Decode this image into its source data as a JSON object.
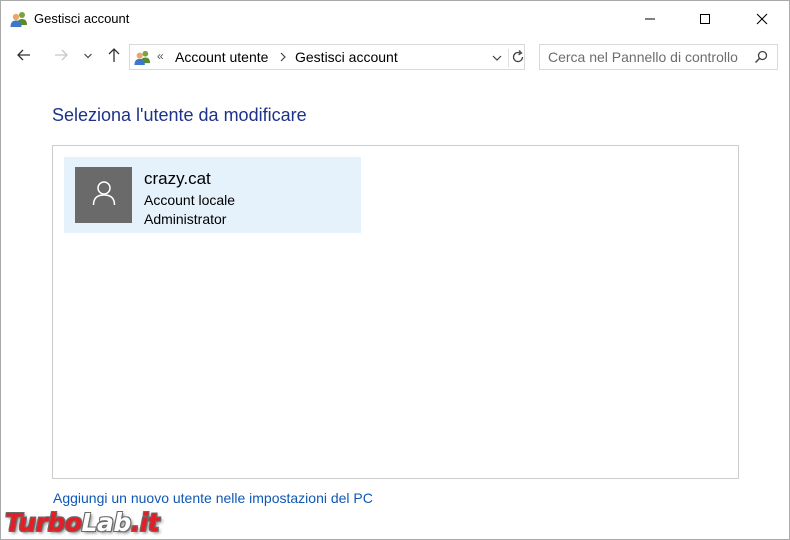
{
  "window": {
    "title": "Gestisci account",
    "icon": "users-icon",
    "controls": {
      "minimize": "minimize-icon",
      "maximize": "maximize-icon",
      "close": "close-icon"
    }
  },
  "navigation": {
    "back_icon": "arrow-left-icon",
    "forward_icon": "arrow-right-icon",
    "recent_icon": "chevron-down-icon",
    "up_icon": "arrow-up-icon"
  },
  "address_bar": {
    "overflow_marker": "«",
    "breadcrumbs": [
      "Account utente",
      "Gestisci account"
    ],
    "refresh_icon": "refresh-icon"
  },
  "search": {
    "placeholder": "Cerca nel Pannello di controllo",
    "value": ""
  },
  "main": {
    "heading": "Seleziona l'utente da modificare",
    "users": [
      {
        "name": "crazy.cat",
        "account_type": "Account locale",
        "role": "Administrator"
      }
    ],
    "add_user_link": "Aggiungi un nuovo utente nelle impostazioni del PC"
  },
  "watermark": {
    "part1": "Turbo",
    "part2": "Lab",
    "part3": ".it"
  },
  "colors": {
    "heading": "#1e3287",
    "link": "#0f58b4",
    "tile_selected": "#e5f1fb",
    "avatar_bg": "#6a6a6a",
    "watermark_red": "#e21f26"
  }
}
